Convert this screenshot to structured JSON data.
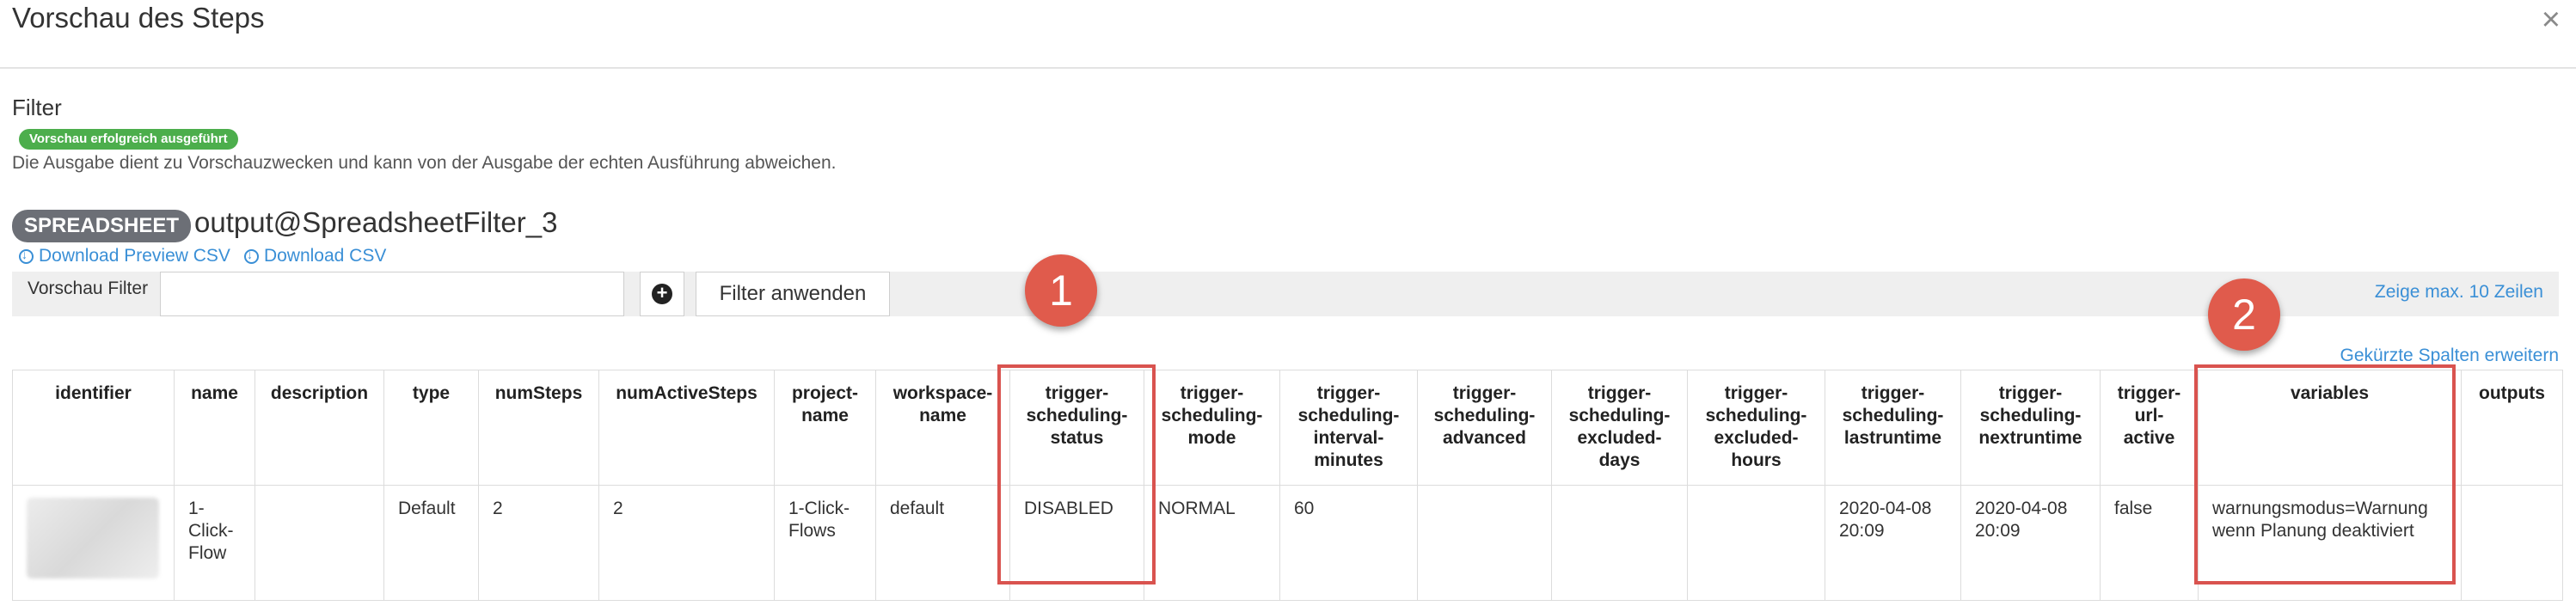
{
  "modal": {
    "title": "Vorschau des Steps",
    "close_label": "×"
  },
  "filter": {
    "heading": "Filter",
    "success_badge": "Vorschau erfolgreich ausgeführt",
    "info_text": "Die Ausgabe dient zu Vorschauzwecken und kann von der Ausgabe der echten Ausführung abweichen."
  },
  "output": {
    "type_badge": "SPREADSHEET",
    "name": "output@SpreadsheetFilter_3",
    "download_preview_csv": "Download Preview CSV",
    "download_csv": "Download CSV"
  },
  "preview_filter": {
    "label": "Vorschau Filter",
    "input_value": "",
    "add_label": "+",
    "apply_label": "Filter anwenden",
    "max_rows_link": "Zeige max. 10 Zeilen",
    "expand_columns_link": "Gekürzte Spalten erweitern"
  },
  "table": {
    "columns": [
      "identifier",
      "name",
      "description",
      "type",
      "numSteps",
      "numActiveSteps",
      "project-name",
      "workspace-name",
      "trigger-scheduling-status",
      "trigger-scheduling-mode",
      "trigger-scheduling-interval-minutes",
      "trigger-scheduling-advanced",
      "trigger-scheduling-excluded-days",
      "trigger-scheduling-excluded-hours",
      "trigger-scheduling-lastruntime",
      "trigger-scheduling-nextruntime",
      "trigger-url-active",
      "variables",
      "outputs"
    ],
    "rows": [
      [
        "",
        "1-Click-Flow",
        "",
        "Default",
        "2",
        "2",
        "1-Click-Flows",
        "default",
        "DISABLED",
        "NORMAL",
        "60",
        "",
        "",
        "",
        "2020-04-08 20:09",
        "2020-04-08 20:09",
        "false",
        "warnungsmodus=Warnung wenn Planung deaktiviert",
        ""
      ]
    ]
  },
  "annotations": {
    "marker_1": "1",
    "marker_2": "2"
  },
  "colors": {
    "accent": "#3a8fd6",
    "success": "#4cae4c",
    "highlight": "#d9534f",
    "marker": "#e05b4c",
    "badge": "#6c6f76"
  }
}
